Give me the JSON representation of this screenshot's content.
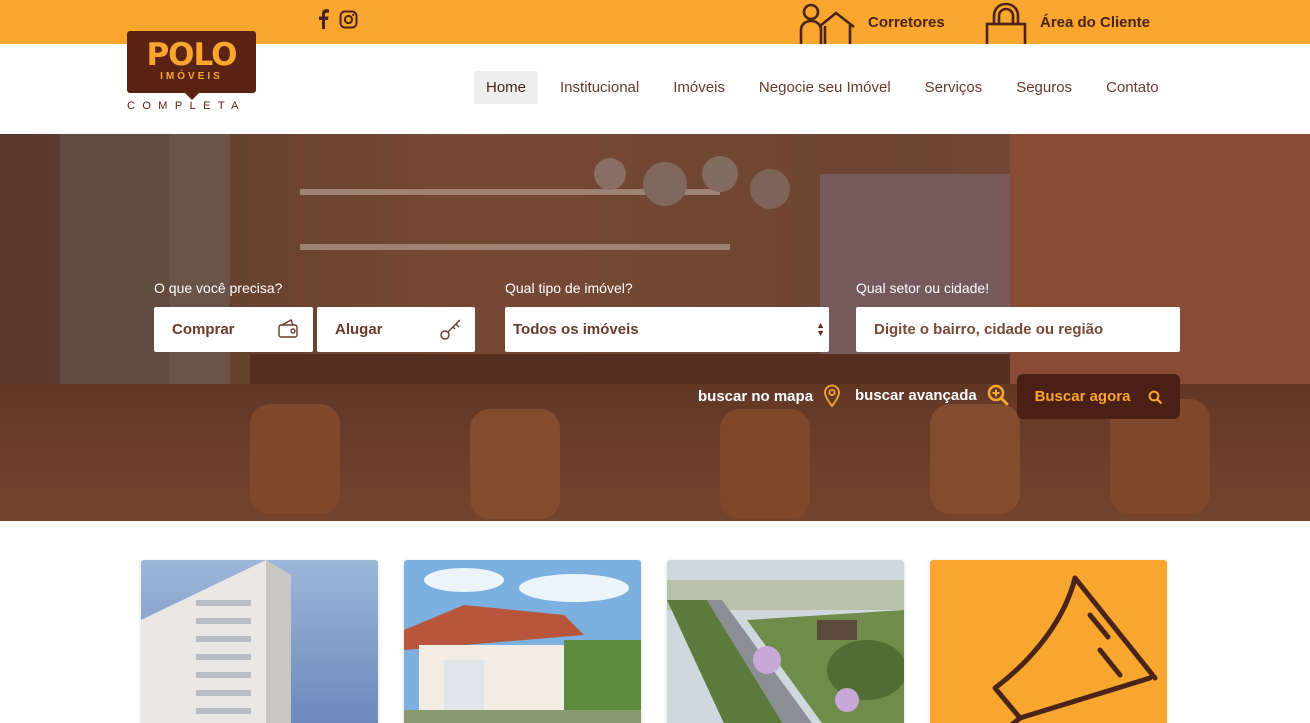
{
  "topbar": {
    "social": [
      {
        "icon": "facebook-icon"
      },
      {
        "icon": "instagram-icon"
      }
    ],
    "corretores_label": "Corretores",
    "cliente_label": "Área do Cliente"
  },
  "logo": {
    "brand": "POLO",
    "sub": "IMÓVEIS",
    "tagline": "COMPLETA"
  },
  "nav": {
    "items": [
      {
        "label": "Home",
        "active": true
      },
      {
        "label": "Institucional"
      },
      {
        "label": "Imóveis"
      },
      {
        "label": "Negocie seu Imóvel"
      },
      {
        "label": "Serviços"
      },
      {
        "label": "Seguros"
      },
      {
        "label": "Contato"
      }
    ]
  },
  "search": {
    "need_label": "O que você precisa?",
    "option_buy": "Comprar",
    "option_rent": "Alugar",
    "type_label": "Qual tipo de imóvel?",
    "type_value": "Todos os imóveis",
    "location_label": "Qual setor ou cidade!",
    "location_placeholder": "Digite o bairro, cidade ou região",
    "map_link": "buscar no mapa",
    "advanced_link": "buscar avançada",
    "submit_label": "Buscar agora"
  },
  "colors": {
    "accent": "#f9a62f",
    "brand_dark": "#5a2314",
    "button_dark": "#4a1f14"
  }
}
